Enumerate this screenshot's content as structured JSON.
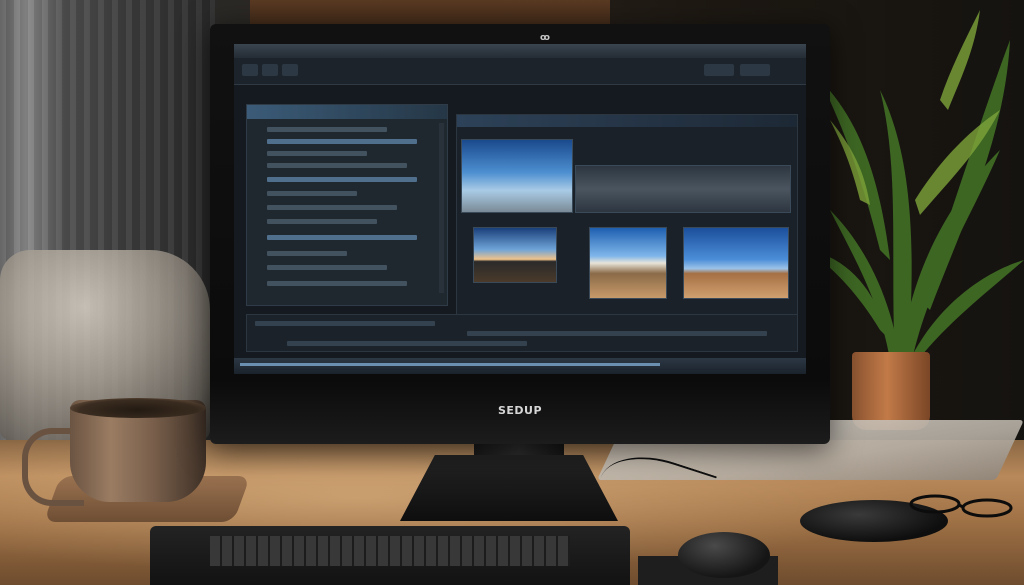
{
  "monitor": {
    "top_logo": "ꝏ",
    "brand_label": "SEDUP"
  },
  "screen": {
    "menubar_items": [
      "",
      "",
      "",
      ""
    ],
    "status_text": ""
  },
  "scene_objects": [
    "curtain",
    "sofa",
    "desk",
    "plant",
    "coffee-mug",
    "monitor",
    "keyboard",
    "mouse",
    "papers",
    "glasses"
  ],
  "colors": {
    "desk": "#b8895a",
    "screen_background": "#151a20",
    "panel_accent": "#3b5b78",
    "pot": "#c27a48"
  }
}
